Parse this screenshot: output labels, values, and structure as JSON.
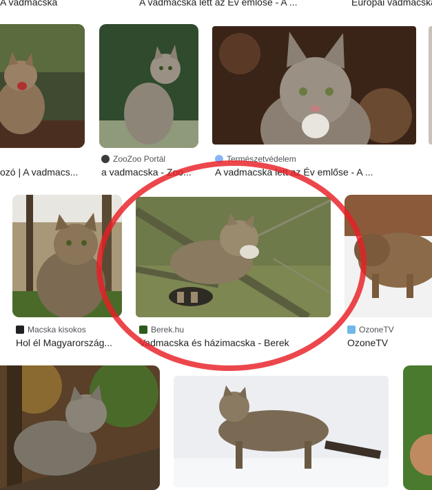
{
  "top_row_captions": [
    "A vadmacska",
    "A vadmacska lett az Év emlőse - A ...",
    "Európai vadmacska"
  ],
  "results": [
    {
      "source": "",
      "caption": "ozó | A vadmacs..."
    },
    {
      "source": "ZooZoo Portál",
      "caption": "a vadmacska - Zoo..."
    },
    {
      "source": "Természetvédelem",
      "caption": "A vadmacska lett az Év emlőse - A ..."
    },
    {
      "source": "Macska kisokos",
      "caption": "Hol él Magyarország..."
    },
    {
      "source": "Berek.hu",
      "caption": "Vadmacska és házimacska - Berek"
    },
    {
      "source": "OzoneTV",
      "caption": "OzoneTV"
    }
  ],
  "colors": {
    "highlight_circle": "#e81e24",
    "caption_text": "#202124",
    "source_text": "#4d5156"
  }
}
